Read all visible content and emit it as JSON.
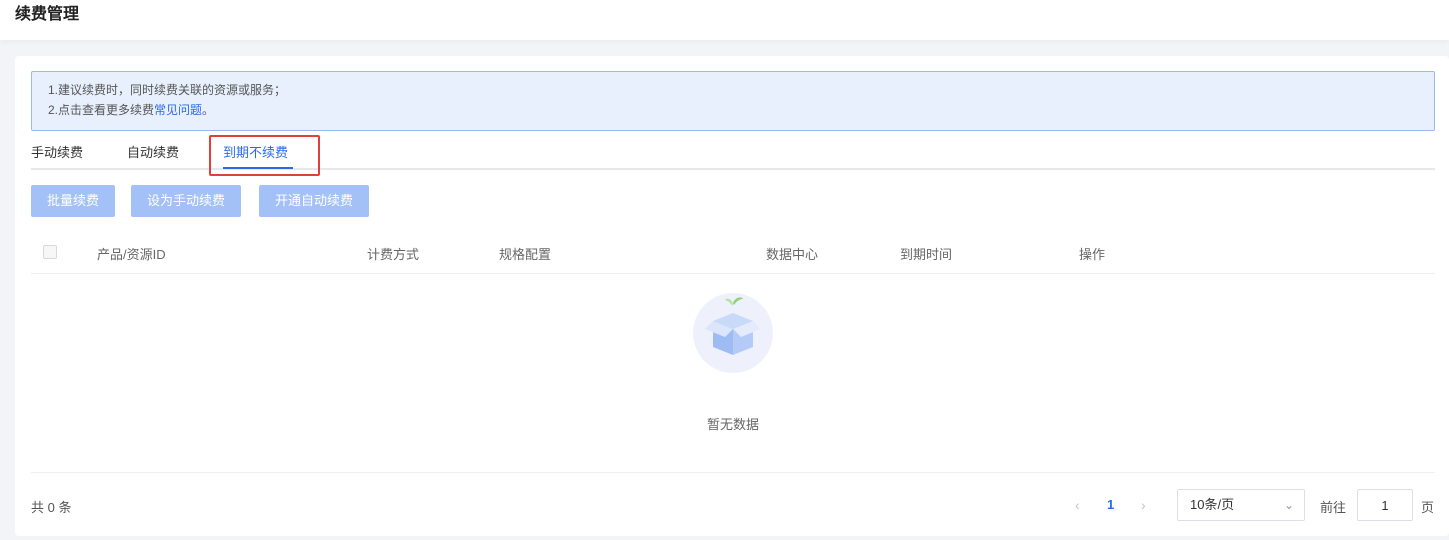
{
  "header": {
    "title": "续费管理"
  },
  "notice": {
    "line1": "1.建议续费时，同时续费关联的资源或服务；",
    "line2_prefix": "2.点击查看更多续费",
    "line2_link": "常见问题",
    "line2_suffix": "。"
  },
  "tabs": [
    {
      "label": "手动续费"
    },
    {
      "label": "自动续费"
    },
    {
      "label": "到期不续费"
    }
  ],
  "active_tab": "到期不续费",
  "toolbar": {
    "batch_label": "批量续费",
    "manual_label": "设为手动续费",
    "auto_label": "开通自动续费"
  },
  "table": {
    "columns": [
      "产品/资源ID",
      "计费方式",
      "规格配置",
      "数据中心",
      "到期时间",
      "操作"
    ],
    "empty_text": "暂无数据"
  },
  "pagination": {
    "total_text": "共 0 条",
    "current_page": "1",
    "page_size": "10条/页",
    "goto_label": "前往",
    "goto_value": "1",
    "page_unit": "页"
  },
  "colors": {
    "accent": "#2a6ae9",
    "highlight": "#e0403a",
    "button_disabled": "#a3c1f7"
  }
}
